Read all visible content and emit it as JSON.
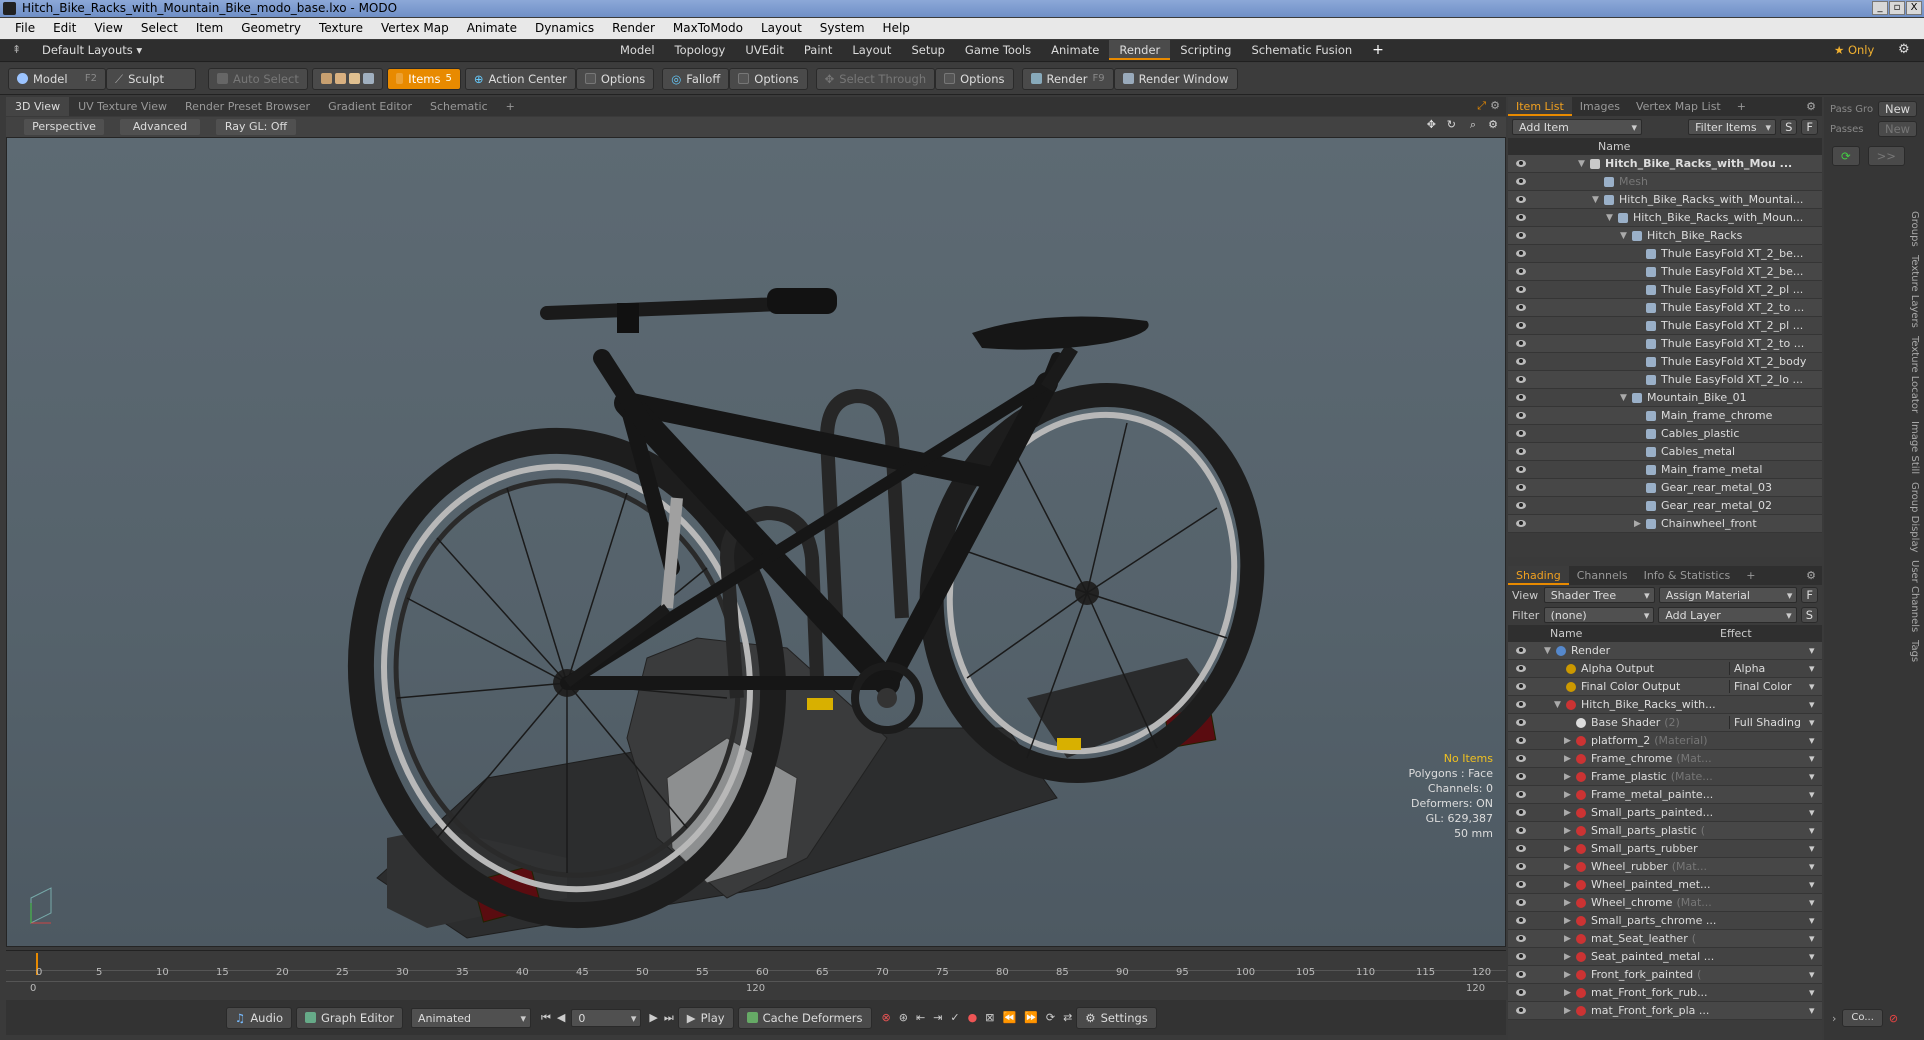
{
  "window": {
    "title": "Hitch_Bike_Racks_with_Mountain_Bike_modo_base.lxo - MODO",
    "min": "_",
    "max": "▫",
    "close": "X"
  },
  "menu": [
    "File",
    "Edit",
    "View",
    "Select",
    "Item",
    "Geometry",
    "Texture",
    "Vertex Map",
    "Animate",
    "Dynamics",
    "Render",
    "MaxToModo",
    "Layout",
    "System",
    "Help"
  ],
  "layout_bar": {
    "layout_name": "Default Layouts ▾",
    "tabs": [
      "Model",
      "Topology",
      "UVEdit",
      "Paint",
      "Layout",
      "Setup",
      "Game Tools",
      "Animate",
      "Render",
      "Scripting",
      "Schematic Fusion"
    ],
    "active": "Render",
    "plus": "+",
    "only": "★  Only"
  },
  "toolbar": {
    "model": "Model",
    "model_key": "F2",
    "sculpt": "Sculpt",
    "auto_select": "Auto Select",
    "items": "Items",
    "items_key": "5",
    "action_center": "Action Center",
    "options1": "Options",
    "falloff": "Falloff",
    "options2": "Options",
    "select_through": "Select Through",
    "options3": "Options",
    "render": "Render",
    "render_key": "F9",
    "render_window": "Render Window"
  },
  "viewport_tabs": [
    "3D View",
    "UV Texture View",
    "Render Preset Browser",
    "Gradient Editor",
    "Schematic",
    "+"
  ],
  "viewport_header": {
    "perspective": "Perspective",
    "advanced": "Advanced",
    "raygl": "Ray GL: Off"
  },
  "hud": {
    "no_items": "No Items",
    "polygons": "Polygons : Face",
    "channels": "Channels: 0",
    "deformers": "Deformers: ON",
    "gl": "GL: 629,387",
    "size": "50 mm"
  },
  "timeline": {
    "ticks": [
      "0",
      "5",
      "10",
      "15",
      "20",
      "25",
      "30",
      "35",
      "40",
      "45",
      "50",
      "55",
      "60",
      "65",
      "70",
      "75",
      "80",
      "85",
      "90",
      "95",
      "100",
      "105",
      "110",
      "115",
      "120"
    ],
    "bottom_left": "0",
    "bottom_mid": "120",
    "bottom_right": "120"
  },
  "transport": {
    "audio": "Audio",
    "graph_editor": "Graph Editor",
    "animated": "Animated",
    "frame": "0",
    "play": "Play",
    "cache_deformers": "Cache Deformers",
    "settings": "Settings"
  },
  "item_list": {
    "tabs": [
      "Item List",
      "Images",
      "Vertex Map List",
      "+"
    ],
    "add_item": "Add Item",
    "filter_items": "Filter Items",
    "s": "S",
    "f": "F",
    "col_name": "Name",
    "rows": [
      {
        "label": "Hitch_Bike_Racks_with_Mou ...",
        "indent": 0,
        "bold": true,
        "tri": "▼"
      },
      {
        "label": "Mesh",
        "indent": 1,
        "dim": true,
        "tri": ""
      },
      {
        "label": "Hitch_Bike_Racks_with_Mountai...",
        "indent": 1,
        "tri": "▼"
      },
      {
        "label": "Hitch_Bike_Racks_with_Moun...",
        "indent": 2,
        "tri": "▼"
      },
      {
        "label": "Hitch_Bike_Racks",
        "indent": 3,
        "tri": "▼"
      },
      {
        "label": "Thule EasyFold XT_2_be...",
        "indent": 4,
        "tri": ""
      },
      {
        "label": "Thule EasyFold XT_2_be...",
        "indent": 4,
        "tri": ""
      },
      {
        "label": "Thule EasyFold XT_2_pl ...",
        "indent": 4,
        "tri": ""
      },
      {
        "label": "Thule EasyFold XT_2_to ...",
        "indent": 4,
        "tri": ""
      },
      {
        "label": "Thule EasyFold XT_2_pl ...",
        "indent": 4,
        "tri": ""
      },
      {
        "label": "Thule EasyFold XT_2_to ...",
        "indent": 4,
        "tri": ""
      },
      {
        "label": "Thule EasyFold XT_2_body",
        "indent": 4,
        "tri": ""
      },
      {
        "label": "Thule EasyFold XT_2_lo ...",
        "indent": 4,
        "tri": ""
      },
      {
        "label": "Mountain_Bike_01",
        "indent": 3,
        "tri": "▼"
      },
      {
        "label": "Main_frame_chrome",
        "indent": 4,
        "tri": ""
      },
      {
        "label": "Cables_plastic",
        "indent": 4,
        "tri": ""
      },
      {
        "label": "Cables_metal",
        "indent": 4,
        "tri": ""
      },
      {
        "label": "Main_frame_metal",
        "indent": 4,
        "tri": ""
      },
      {
        "label": "Gear_rear_metal_03",
        "indent": 4,
        "tri": ""
      },
      {
        "label": "Gear_rear_metal_02",
        "indent": 4,
        "tri": ""
      },
      {
        "label": "Chainwheel_front",
        "indent": 4,
        "tri": "▶"
      }
    ]
  },
  "shading": {
    "tabs": [
      "Shading",
      "Channels",
      "Info & Statistics",
      "+"
    ],
    "view_label": "View",
    "view_value": "Shader Tree",
    "assign_material": "Assign Material",
    "f": "F",
    "filter_label": "Filter",
    "filter_value": "(none)",
    "add_layer": "Add Layer",
    "s": "S",
    "col_name": "Name",
    "col_effect": "Effect",
    "rows": [
      {
        "label": "Render",
        "sub": "",
        "effect": "",
        "indent": 0,
        "tri": "▼"
      },
      {
        "label": "Alpha Output",
        "sub": "",
        "effect": "Alpha",
        "indent": 1,
        "tri": ""
      },
      {
        "label": "Final Color Output",
        "sub": "",
        "effect": "Final Color",
        "indent": 1,
        "tri": ""
      },
      {
        "label": "Hitch_Bike_Racks_with...",
        "sub": "",
        "effect": "",
        "indent": 1,
        "tri": "▼"
      },
      {
        "label": "Base Shader",
        "sub": "(2)",
        "effect": "Full Shading",
        "indent": 2,
        "tri": ""
      },
      {
        "label": "platform_2",
        "sub": "(Material)",
        "effect": "",
        "indent": 2,
        "tri": "▶"
      },
      {
        "label": "Frame_chrome",
        "sub": "(Mat...",
        "effect": "",
        "indent": 2,
        "tri": "▶"
      },
      {
        "label": "Frame_plastic",
        "sub": "(Mate...",
        "effect": "",
        "indent": 2,
        "tri": "▶"
      },
      {
        "label": "Frame_metal_painte...",
        "sub": "",
        "effect": "",
        "indent": 2,
        "tri": "▶"
      },
      {
        "label": "Small_parts_painted...",
        "sub": "",
        "effect": "",
        "indent": 2,
        "tri": "▶"
      },
      {
        "label": "Small_parts_plastic",
        "sub": "(",
        "effect": "",
        "indent": 2,
        "tri": "▶"
      },
      {
        "label": "Small_parts_rubber",
        "sub": "",
        "effect": "",
        "indent": 2,
        "tri": "▶"
      },
      {
        "label": "Wheel_rubber",
        "sub": "(Mat...",
        "effect": "",
        "indent": 2,
        "tri": "▶"
      },
      {
        "label": "Wheel_painted_met...",
        "sub": "",
        "effect": "",
        "indent": 2,
        "tri": "▶"
      },
      {
        "label": "Wheel_chrome",
        "sub": "(Mat...",
        "effect": "",
        "indent": 2,
        "tri": "▶"
      },
      {
        "label": "Small_parts_chrome ...",
        "sub": "",
        "effect": "",
        "indent": 2,
        "tri": "▶"
      },
      {
        "label": "mat_Seat_leather",
        "sub": "(",
        "effect": "",
        "indent": 2,
        "tri": "▶"
      },
      {
        "label": "Seat_painted_metal ...",
        "sub": "",
        "effect": "",
        "indent": 2,
        "tri": "▶"
      },
      {
        "label": "Front_fork_painted",
        "sub": "(",
        "effect": "",
        "indent": 2,
        "tri": "▶"
      },
      {
        "label": "mat_Front_fork_rub...",
        "sub": "",
        "effect": "",
        "indent": 2,
        "tri": "▶"
      },
      {
        "label": "mat_Front_fork_pla ...",
        "sub": "",
        "effect": "",
        "indent": 2,
        "tri": "▶"
      }
    ]
  },
  "far_right": {
    "pass_gro": "Pass Gro",
    "new1": "New",
    "passes": "Passes",
    "new2": "New",
    "arrows": ">>",
    "side_tabs": [
      "Groups",
      "Texture Layers",
      "Texture Locator",
      "Image Still",
      "Group Display",
      "User Channels",
      "Tags"
    ],
    "co": "Co..."
  }
}
